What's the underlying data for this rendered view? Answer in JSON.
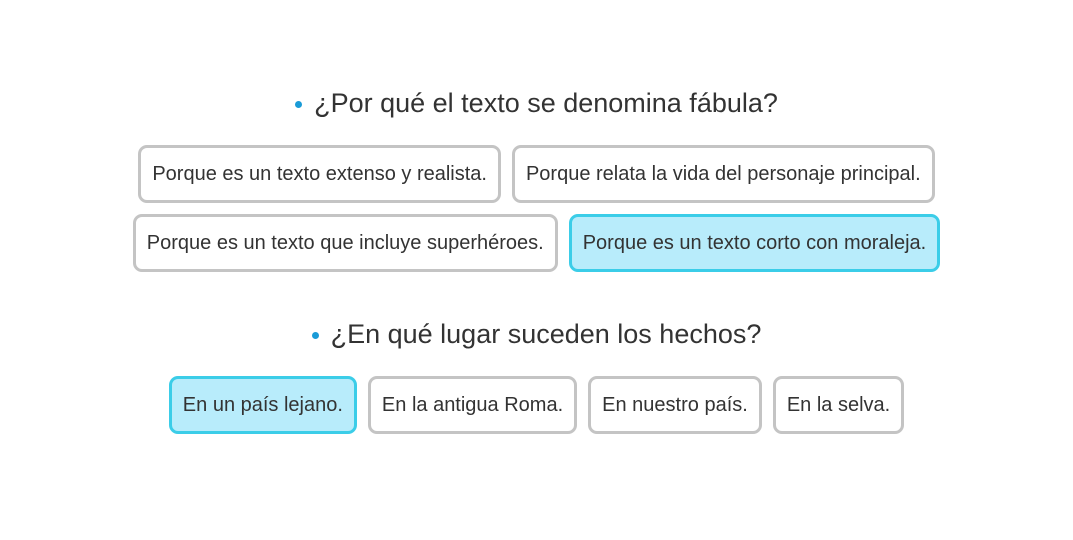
{
  "questions": [
    {
      "prompt": "¿Por qué el texto se denomina fábula?",
      "rows": [
        [
          {
            "label": "Porque es un texto extenso y realista.",
            "selected": false
          },
          {
            "label": "Porque relata la vida del personaje principal.",
            "selected": false
          }
        ],
        [
          {
            "label": "Porque es un texto que incluye superhéroes.",
            "selected": false
          },
          {
            "label": "Porque es un texto corto con moraleja.",
            "selected": true
          }
        ]
      ]
    },
    {
      "prompt": "¿En qué lugar suceden los hechos?",
      "rows": [
        [
          {
            "label": "En un país lejano.",
            "selected": true
          },
          {
            "label": "En la antigua Roma.",
            "selected": false
          },
          {
            "label": "En nuestro país.",
            "selected": false
          },
          {
            "label": "En la selva.",
            "selected": false
          }
        ]
      ]
    }
  ],
  "colors": {
    "bullet": "#1a9bd7",
    "option_border": "#c4c4c4",
    "selected_background": "#b8ecfb",
    "selected_border": "#3bcde8",
    "text": "#333333"
  },
  "icons": {
    "bullet": "bullet-icon"
  }
}
